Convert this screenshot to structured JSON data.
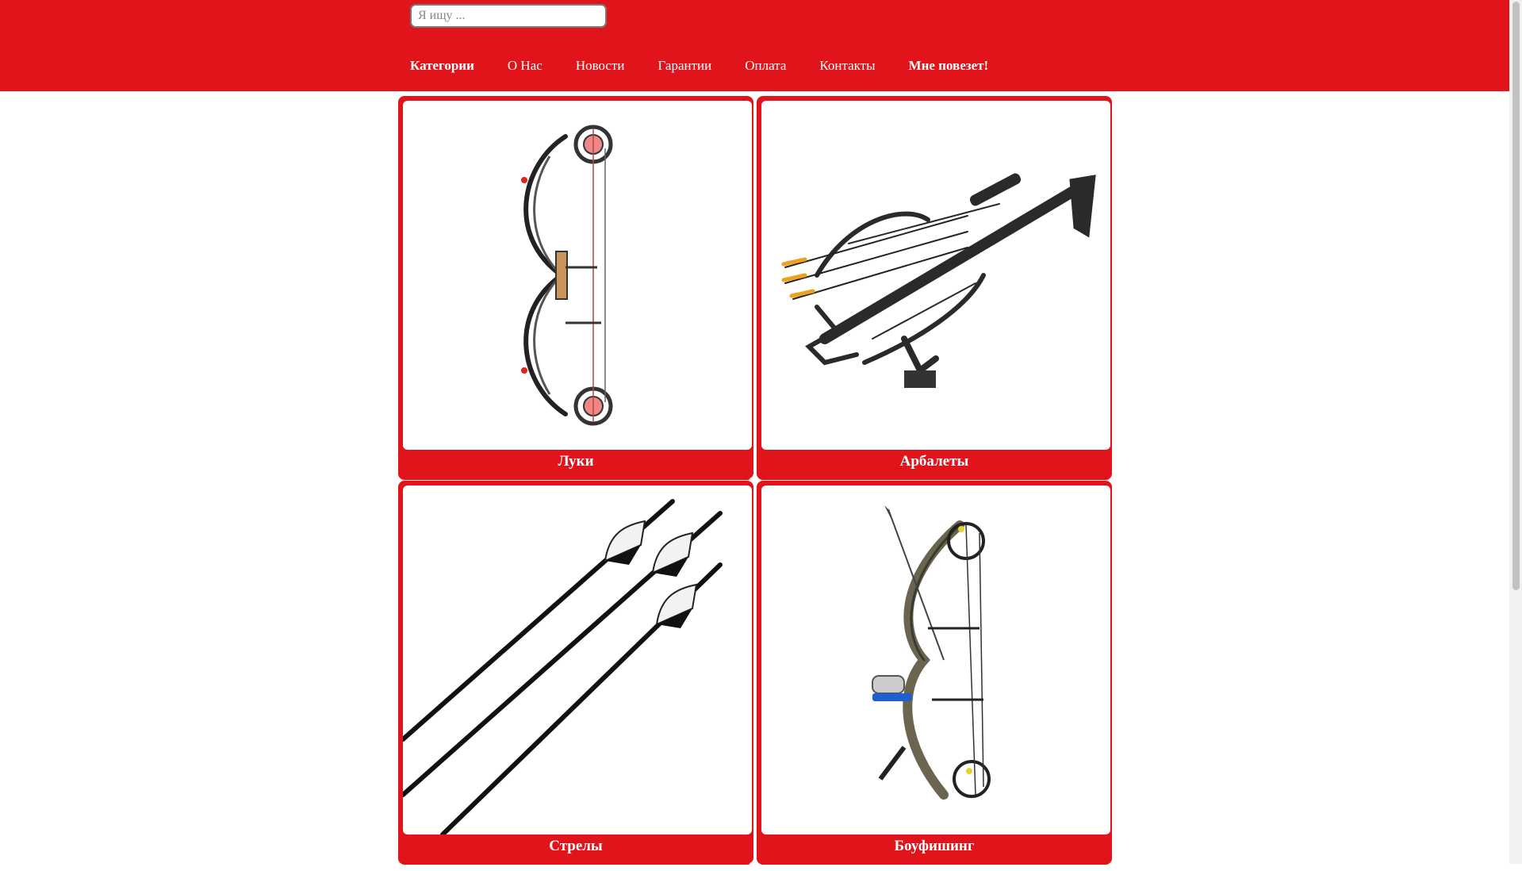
{
  "search": {
    "placeholder": "Я ищу ..."
  },
  "nav": {
    "items": [
      {
        "label": "Категории"
      },
      {
        "label": "О Нас"
      },
      {
        "label": "Новости"
      },
      {
        "label": "Гарантии"
      },
      {
        "label": "Оплата"
      },
      {
        "label": "Контакты"
      },
      {
        "label": "Мне повезет!"
      }
    ]
  },
  "categories": [
    {
      "label": "Луки",
      "icon": "compound-bow-image"
    },
    {
      "label": "Арбалеты",
      "icon": "crossbow-image"
    },
    {
      "label": "Стрелы",
      "icon": "arrows-image"
    },
    {
      "label": "Боуфишинг",
      "icon": "bowfishing-bow-image"
    }
  ],
  "colors": {
    "brand": "#e0141a"
  }
}
